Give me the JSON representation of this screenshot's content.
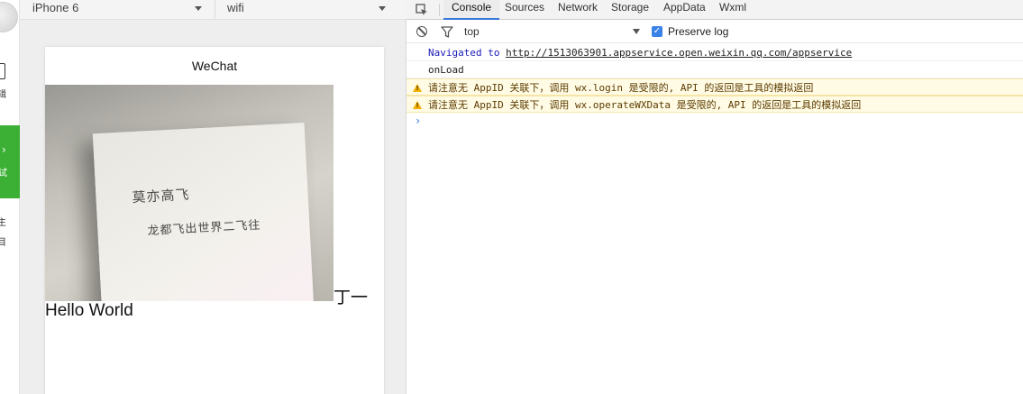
{
  "sidebar": {
    "edit_label": "辑",
    "debug_label": "试",
    "debug_chevron": "›",
    "project_label_1": "主",
    "project_label_2": "目"
  },
  "simulator": {
    "device": "iPhone 6",
    "network": "wifi",
    "nav_title": "WeChat",
    "caption": "丁一",
    "hello": "Hello World",
    "handwriting_line1": "莫亦高飞",
    "handwriting_line2": "龙都飞出世界二飞往"
  },
  "devtools": {
    "tabs": [
      "Console",
      "Sources",
      "Network",
      "Storage",
      "AppData",
      "Wxml"
    ],
    "active_tab": "Console",
    "context": "top",
    "preserve_log_label": "Preserve log",
    "preserve_log_checked": true,
    "console": {
      "nav_prefix": "Navigated to",
      "nav_url": "http://1513063901.appservice.open.weixin.qq.com/appservice",
      "log_onload": "onLoad",
      "warn_1": "请注意无 AppID 关联下，调用 wx.login 是受限的, API 的返回是工具的模拟返回",
      "warn_2": "请注意无 AppID 关联下，调用 wx.operateWXData 是受限的, API 的返回是工具的模拟返回",
      "prompt": "›"
    }
  },
  "colors": {
    "accent": "#3879d9",
    "green": "#3cb035",
    "warning_bg": "#fffbe5",
    "warning_icon": "#f2b000"
  }
}
